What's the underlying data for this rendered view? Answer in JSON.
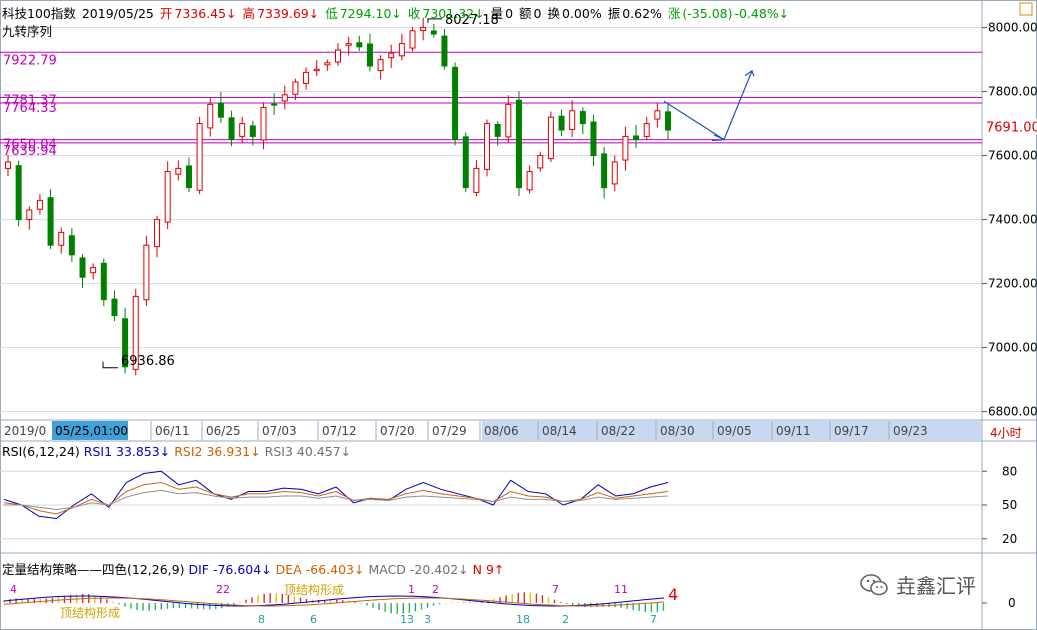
{
  "header": {
    "name": "科技100指数",
    "date": "2019/05/25",
    "open_label": "开",
    "open": "7336.45↓",
    "high_label": "高",
    "high": "7339.69↓",
    "low_label": "低",
    "low": "7294.10↓",
    "close_label": "收",
    "close": "7301.32↓",
    "vol_label": "量",
    "vol": "0",
    "amount_label": "额",
    "amount": "0",
    "turnover_label": "换",
    "turnover": "0.00%",
    "amp_label": "振",
    "amp": "0.62%",
    "chg_label": "涨",
    "chg": "(-35.08)",
    "chg_pct": "-0.48%↓"
  },
  "subtitle": "九转序列",
  "price_levels": [
    "7922.79",
    "7781.37",
    "7764.33",
    "7650.04",
    "7639.94"
  ],
  "current_price": "7691.00",
  "annotations": {
    "high_price": "8027.18",
    "low_price": "6936.86"
  },
  "time_axis": {
    "selected": "05/25,01:00",
    "start": "2019/0",
    "labels": [
      "06/11",
      "06/25",
      "07/03",
      "07/12",
      "07/20",
      "07/29",
      "08/06",
      "08/14",
      "08/22",
      "08/30",
      "09/05",
      "09/11",
      "09/17",
      "09/23"
    ]
  },
  "timeframe": "4小时",
  "rsi": {
    "title": "RSI(6,12,24)",
    "rsi1_label": "RSI1",
    "rsi1": "33.853↓",
    "rsi2_label": "RSI2",
    "rsi2": "36.931↓",
    "rsi3_label": "RSI3",
    "rsi3": "40.457↓",
    "axis": [
      "80",
      "50",
      "20"
    ]
  },
  "macd": {
    "title": "定量结构策略——四色(12,26,9)",
    "dif_label": "DIF",
    "dif": "-76.604↓",
    "dea_label": "DEA",
    "dea": "-66.403↓",
    "macd_label": "MACD",
    "macd": "-20.402↓",
    "n_label": "N",
    "n": "9↑",
    "axis_zero": "0",
    "marker": "4",
    "labels_pink": [
      "4",
      "22",
      "1",
      "2",
      "7",
      "11"
    ],
    "labels_cyan": [
      "8",
      "6",
      "13",
      "3",
      "18",
      "2",
      "7"
    ],
    "text_yellow": [
      "顶结构形成",
      "顶结构形成"
    ]
  },
  "watermark": "垚鑫汇评",
  "chart_data": {
    "type": "candlestick",
    "title": "科技100指数",
    "xlabel": "",
    "ylabel": "",
    "ylim": [
      6780,
      8080
    ],
    "y_ticks": [
      6800,
      7000,
      7200,
      7400,
      7600,
      7800,
      8000
    ],
    "x_ticks": [
      "06/11",
      "06/25",
      "07/03",
      "07/12",
      "07/20",
      "07/29",
      "08/06",
      "08/14",
      "08/22",
      "08/30",
      "09/05",
      "09/11",
      "09/17",
      "09/23"
    ],
    "levels": [
      7922.79,
      7781.37,
      7764.33,
      7650.04,
      7639.94
    ],
    "close_path": [
      7580,
      7400,
      7430,
      7460,
      7320,
      7360,
      7290,
      7220,
      7250,
      7150,
      7100,
      6940,
      7160,
      7320,
      7400,
      7550,
      7560,
      7500,
      7700,
      7760,
      7720,
      7650,
      7700,
      7660,
      7750,
      7760,
      7790,
      7830,
      7860,
      7870,
      7890,
      7930,
      7950,
      7940,
      7880,
      7900,
      7920,
      7950,
      7990,
      8000,
      7980,
      7880,
      7650,
      7500,
      7560,
      7700,
      7660,
      7760,
      7500,
      7550,
      7600,
      7720,
      7680,
      7740,
      7700,
      7600,
      7500,
      7580,
      7660,
      7650,
      7700,
      7740,
      7680
    ],
    "series": [
      {
        "name": "RSI1",
        "values": [
          55,
          50,
          40,
          38,
          50,
          60,
          48,
          70,
          78,
          80,
          68,
          72,
          60,
          55,
          62,
          62,
          65,
          64,
          60,
          66,
          52,
          56,
          54,
          64,
          70,
          64,
          60,
          56,
          50,
          72,
          62,
          60,
          50,
          55,
          68,
          58,
          60,
          66,
          70
        ]
      },
      {
        "name": "RSI2",
        "values": [
          52,
          50,
          45,
          42,
          48,
          55,
          50,
          62,
          68,
          70,
          64,
          66,
          60,
          57,
          60,
          60,
          62,
          61,
          58,
          62,
          54,
          56,
          55,
          60,
          63,
          60,
          58,
          56,
          53,
          62,
          58,
          57,
          53,
          55,
          61,
          56,
          58,
          60,
          62
        ]
      },
      {
        "name": "RSI3",
        "values": [
          50,
          50,
          48,
          46,
          48,
          52,
          50,
          57,
          61,
          63,
          60,
          61,
          58,
          56,
          57,
          57,
          58,
          58,
          56,
          58,
          54,
          55,
          54,
          57,
          58,
          57,
          56,
          55,
          53,
          57,
          55,
          55,
          53,
          54,
          57,
          55,
          56,
          57,
          58
        ]
      }
    ]
  }
}
